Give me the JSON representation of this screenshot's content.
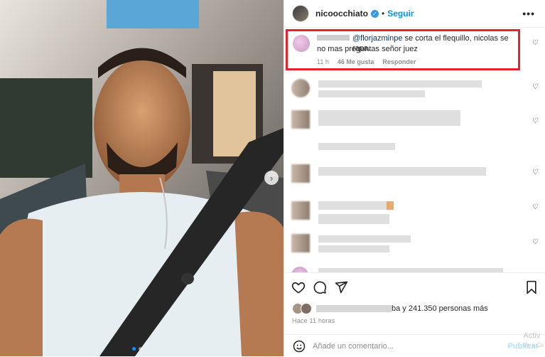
{
  "post": {
    "username": "nicoocchiato",
    "separator": "•",
    "follow_label": "Seguir",
    "more_label": "•••"
  },
  "comments": [
    {
      "mention": "@florjazminpe",
      "text": " se corta el flequillo, nicolas se rapa.",
      "text2": "no mas preguntas señor juez",
      "time": "11 h",
      "likes": "46 Me gusta",
      "reply": "Responder",
      "highlighted": true
    }
  ],
  "actions": {
    "likes_text": "ba y 241.350 personas más",
    "time_ago": "Hace 11 horas",
    "comment_placeholder": "Añade un comentario...",
    "publish_label": "Publicar"
  },
  "overlay": {
    "watermark_line1": "Activ",
    "watermark_line2": "Ve a Co"
  },
  "colors": {
    "accent": "#0095f6",
    "highlight": "#e8212b",
    "verified": "#3897f0"
  },
  "icons": [
    "heart-icon",
    "comment-icon",
    "share-icon",
    "bookmark-icon",
    "emoji-icon",
    "verified-icon",
    "chevron-right-icon"
  ]
}
